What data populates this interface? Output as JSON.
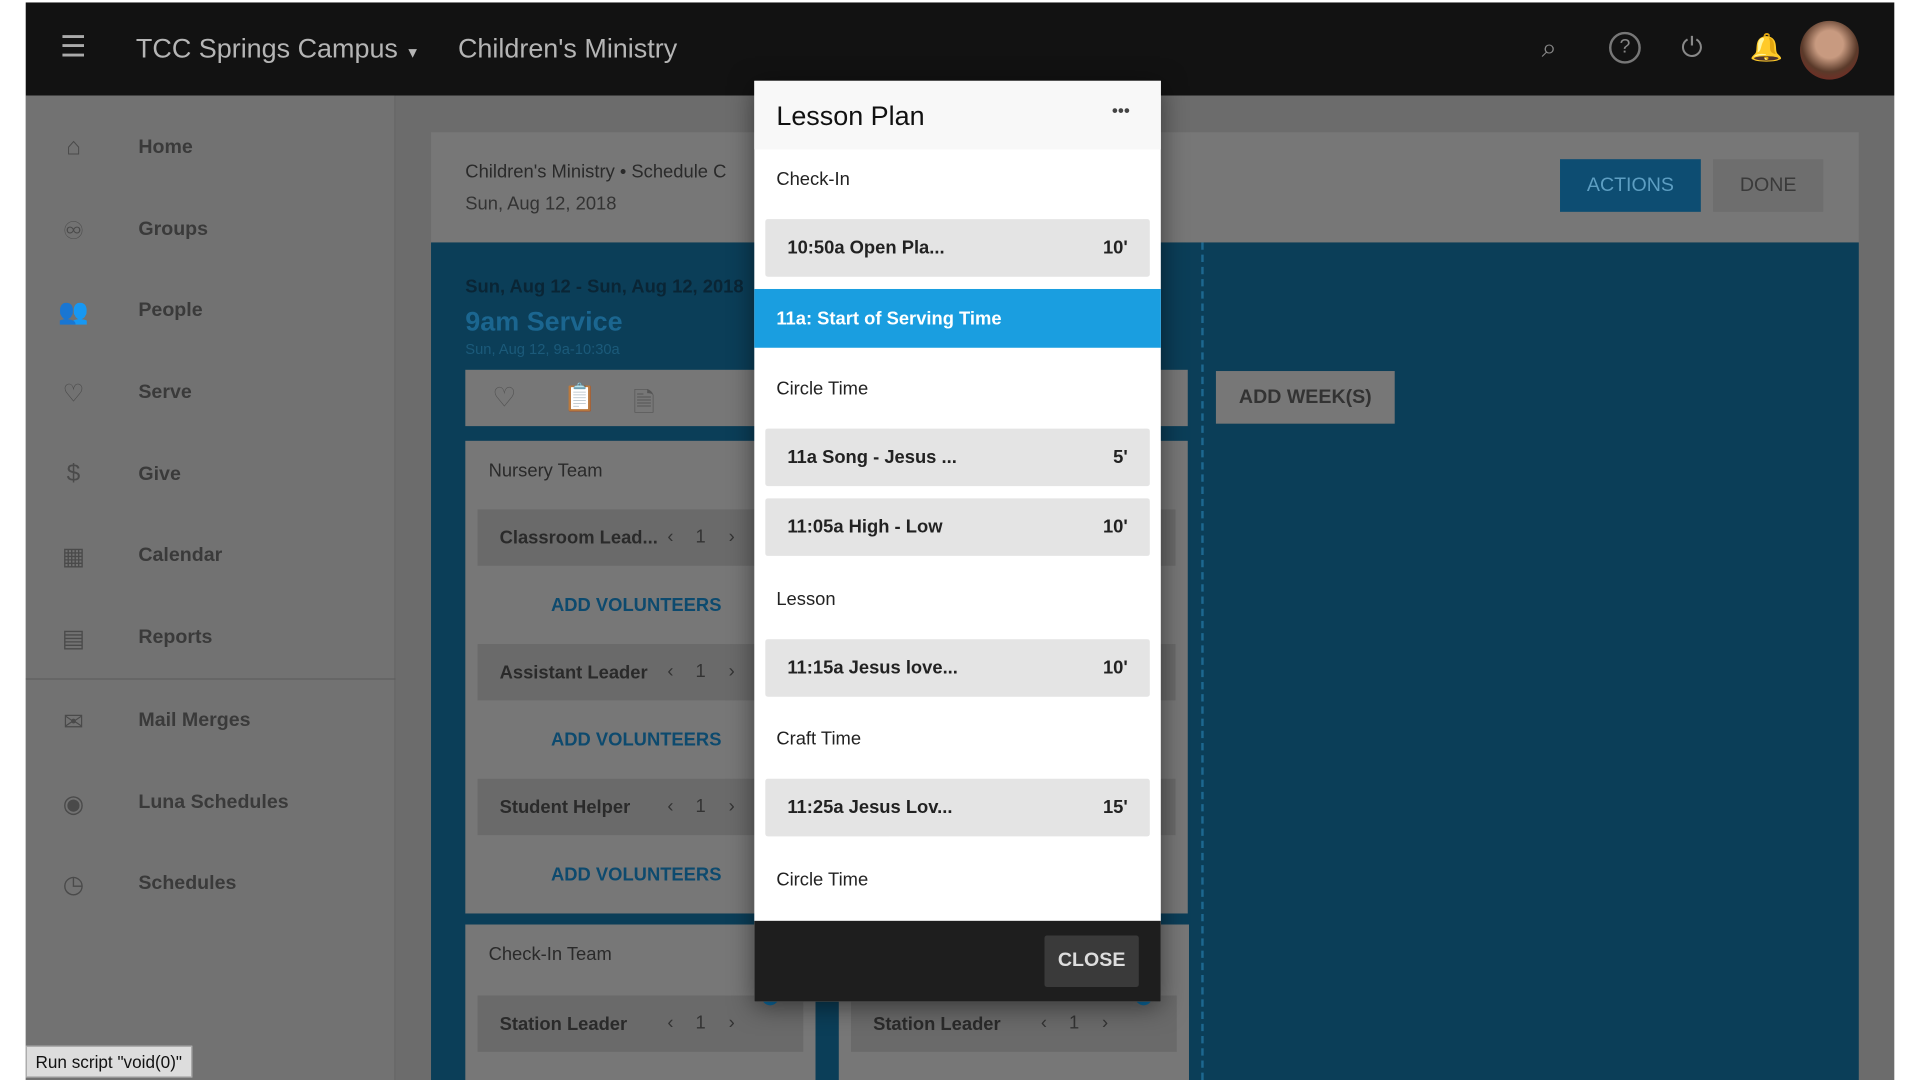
{
  "header": {
    "campus": "TCC Springs Campus",
    "ministry": "Children's Ministry"
  },
  "sidebar": {
    "items": [
      {
        "label": "Home",
        "icon": "home-icon",
        "glyph": "⌂"
      },
      {
        "label": "Groups",
        "icon": "groups-icon",
        "glyph": "♾"
      },
      {
        "label": "People",
        "icon": "people-icon",
        "glyph": "👥"
      },
      {
        "label": "Serve",
        "icon": "heart-icon",
        "glyph": "♡"
      },
      {
        "label": "Give",
        "icon": "dollar-icon",
        "glyph": "$"
      },
      {
        "label": "Calendar",
        "icon": "calendar-icon",
        "glyph": "▦"
      },
      {
        "label": "Reports",
        "icon": "reports-icon",
        "glyph": "▤"
      },
      {
        "label": "Mail Merges",
        "icon": "mail-icon",
        "glyph": "✉"
      },
      {
        "label": "Luna Schedules",
        "icon": "luna-icon",
        "glyph": "◉"
      },
      {
        "label": "Schedules",
        "icon": "clock-icon",
        "glyph": "◷"
      }
    ]
  },
  "main": {
    "breadcrumb": "Children's Ministry • Schedule C",
    "date": "Sun, Aug 12, 2018",
    "actions": "ACTIONS",
    "done": "DONE",
    "range": "Sun, Aug 12 - Sun, Aug 12, 2018",
    "service": "9am Service",
    "service_time": "Sun, Aug 12, 9a-10:30a",
    "add_weeks": "ADD WEEK(S)",
    "nursery": {
      "title": "Nursery Team",
      "roles": [
        {
          "name": "Classroom Lead...",
          "count": "1"
        },
        {
          "name": "Assistant Leader",
          "count": "1"
        },
        {
          "name": "Student Helper",
          "count": "1"
        }
      ],
      "add": "ADD VOLUNTEERS"
    },
    "checkin": {
      "title": "Check-In Team",
      "role": "Station Leader",
      "count": "1",
      "badge": "1"
    },
    "col2": {
      "role": "Station Leader",
      "count": "1",
      "badge": "1"
    }
  },
  "modal": {
    "title": "Lesson Plan",
    "more": "•••",
    "close": "CLOSE",
    "entries": [
      {
        "type": "section",
        "label": "Check-In"
      },
      {
        "type": "item",
        "label": "10:50a Open Pla...",
        "dur": "10'"
      },
      {
        "type": "active",
        "label": "11a: Start of Serving Time"
      },
      {
        "type": "section",
        "label": "Circle Time"
      },
      {
        "type": "item",
        "label": "11a Song - Jesus ...",
        "dur": "5'"
      },
      {
        "type": "item",
        "label": "11:05a High - Low",
        "dur": "10'"
      },
      {
        "type": "section",
        "label": "Lesson"
      },
      {
        "type": "item",
        "label": "11:15a Jesus love...",
        "dur": "10'"
      },
      {
        "type": "section",
        "label": "Craft Time"
      },
      {
        "type": "item",
        "label": "11:25a Jesus Lov...",
        "dur": "15'"
      },
      {
        "type": "section",
        "label": "Circle Time"
      }
    ]
  },
  "status": "Run script \"void(0)\"",
  "colors": {
    "accent": "#1a9ee0",
    "header": "#121212"
  }
}
